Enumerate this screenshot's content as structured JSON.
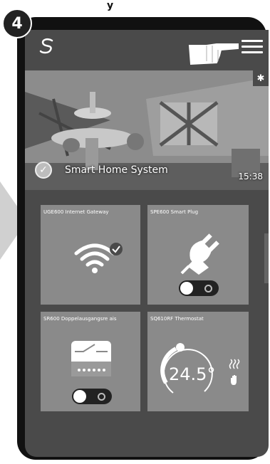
{
  "step": {
    "number": "4"
  },
  "top_partial_text": "y",
  "header": {
    "logo_icon": "s-logo-icon",
    "menu_icon": "hamburger-menu-icon"
  },
  "hero": {
    "title": "Smart Home System",
    "time": "15:38",
    "settings_icon": "gear-icon"
  },
  "tiles": [
    {
      "label": "UGE600 Internet Gateway",
      "icon": "wifi-icon",
      "status_icon": "check-icon"
    },
    {
      "label": "SPE600 Smart Plug",
      "icon": "plug-icon",
      "toggle": "off"
    },
    {
      "label": "SR600 Doppelausgangsre ais",
      "icon": "relay-icon",
      "toggle": "off"
    },
    {
      "label": "SQ610RF Thermostat",
      "icon": "thermostat-icon",
      "temperature": "24.5°"
    }
  ],
  "colors": {
    "screen_bg": "#4a4a4a",
    "tile_bg": "#8a8a8a",
    "phone_body": "#111111"
  }
}
